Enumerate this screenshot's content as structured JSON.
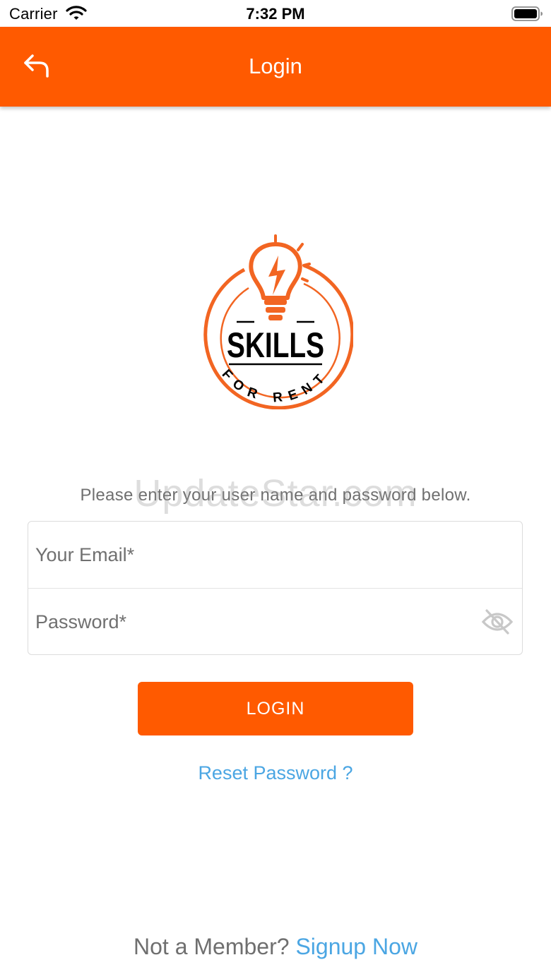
{
  "status_bar": {
    "carrier": "Carrier",
    "time": "7:32 PM"
  },
  "app_bar": {
    "title": "Login",
    "color": "#FF5A00"
  },
  "logo": {
    "wordmark": "SKILLS",
    "tagline": "FOR RENT",
    "color": "#F26522"
  },
  "instruction": "Please enter your user name and password below.",
  "watermark": "UpdateStar.com",
  "form": {
    "email": {
      "placeholder": "Your Email*",
      "value": ""
    },
    "password": {
      "placeholder": "Password*",
      "value": ""
    }
  },
  "login_button": {
    "label": "LOGIN"
  },
  "reset_link": "Reset Password ?",
  "signup": {
    "prompt": "Not a Member?",
    "link": "Signup Now"
  },
  "colors": {
    "accent": "#FF5A00",
    "link": "#4BA6E3",
    "muted_text": "#6F6F6F"
  }
}
